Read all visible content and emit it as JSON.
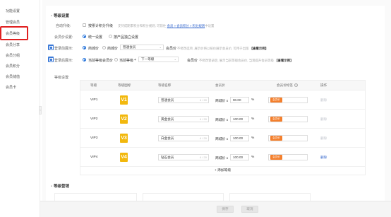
{
  "sidebar": {
    "items": [
      {
        "label": "功能设置"
      },
      {
        "label": "管理会员"
      },
      {
        "label": "会员等级"
      },
      {
        "label": "会员分享"
      },
      {
        "label": "会员分组"
      },
      {
        "label": "会员积分"
      },
      {
        "label": "会员储值"
      },
      {
        "label": "会员卡"
      }
    ],
    "highlighted_index": 2
  },
  "level_settings": {
    "section_title": "等级设置",
    "auto_upgrade": {
      "label": "自动升级:",
      "option": "按累计积分升级",
      "hint_pre": "支持成期累积分和积分规则, 可前往",
      "hint_link": "会员 » 会员积分 » 积分规则",
      "hint_post": "中设置"
    },
    "member_price": {
      "label": "会员价设置:",
      "opt1": "统一设置",
      "opt2": "按产品独立设置"
    },
    "show_price": {
      "label": "登录前展示:",
      "opt1": "商城价",
      "opt2": "商城价",
      "select": "普通会员",
      "suffix": "会员价",
      "hint": "不修改选项, 展示价将以按价展示会员价, 可用于出版",
      "link": "【查看示例】"
    },
    "after_login": {
      "label": "登录后展示:",
      "opt1": "当前等级会员价",
      "opt2": "当前等级",
      "select": "下一等级",
      "suffix": "会员价",
      "hint": "不修改登录后, 展示当前等级会员价, 当现提升会员等级",
      "link": "【查看示例】"
    },
    "levels_label": "等级设置:",
    "table": {
      "headers": [
        "等级",
        "等级图标",
        "等级名称",
        "会员价",
        "会员价标签",
        "操作"
      ],
      "rows": [
        {
          "level": "VIP1",
          "icon": "V1",
          "name": "普通会员",
          "count": "4 / 20",
          "price_prefix": "商城价 x",
          "discount": "90.00",
          "pct": "%",
          "tag": "会员价",
          "action": "删除",
          "action_active": false
        },
        {
          "level": "VIP2",
          "icon": "V2",
          "name": "黄金会员",
          "count": "4 / 20",
          "price_prefix": "商城价 x",
          "discount": "100.00",
          "pct": "%",
          "tag": "会员价",
          "action": "删除",
          "action_active": false
        },
        {
          "level": "VIP3",
          "icon": "V3",
          "name": "白金会员",
          "count": "4 / 20",
          "price_prefix": "商城价 x",
          "discount": "100.00",
          "pct": "%",
          "tag": "会员价",
          "action": "删除",
          "action_active": false
        },
        {
          "level": "VIP4",
          "icon": "V4",
          "name": "钻石会员",
          "count": "4 / 20",
          "price_prefix": "商城价 x",
          "discount": "100.00",
          "pct": "%",
          "tag": "会员价",
          "action": "删除",
          "action_active": true
        }
      ],
      "add_label": "+ 添加等级"
    }
  },
  "benefits": {
    "section_title": "等级营销"
  },
  "footer": {
    "save": "保存",
    "cancel": "取消"
  },
  "colors": {
    "accent": "#1e6fd9",
    "link": "#3366cc",
    "highlight_border": "#e02020",
    "tag_orange": "#f47f2c",
    "icon_gold": "#f2b80d"
  }
}
